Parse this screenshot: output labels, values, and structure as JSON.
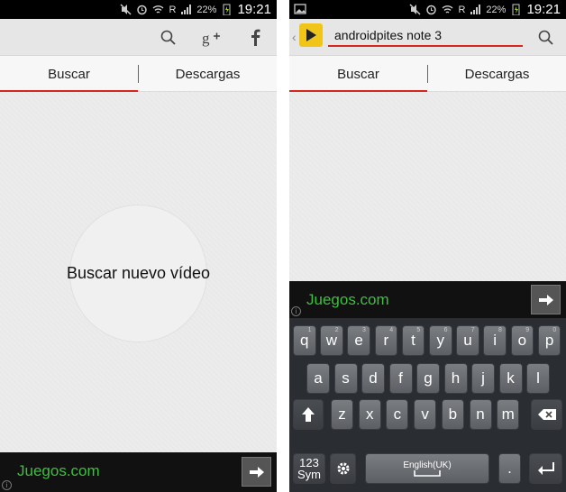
{
  "status": {
    "battery_pct": "22%",
    "time": "19:21",
    "signal_label": "R"
  },
  "left_screen": {
    "tabs": [
      {
        "label": "Buscar"
      },
      {
        "label": "Descargas"
      }
    ],
    "circle_label": "Buscar nuevo vídeo",
    "ad": {
      "text": "Juegos.com",
      "info": "i"
    }
  },
  "right_screen": {
    "search": {
      "value": "androidpites note 3",
      "placeholder": ""
    },
    "tabs": [
      {
        "label": "Buscar"
      },
      {
        "label": "Descargas"
      }
    ],
    "ad": {
      "text": "Juegos.com",
      "info": "i"
    },
    "keyboard": {
      "row1": [
        {
          "k": "q",
          "h": "1"
        },
        {
          "k": "w",
          "h": "2"
        },
        {
          "k": "e",
          "h": "3"
        },
        {
          "k": "r",
          "h": "4"
        },
        {
          "k": "t",
          "h": "5"
        },
        {
          "k": "y",
          "h": "6"
        },
        {
          "k": "u",
          "h": "7"
        },
        {
          "k": "i",
          "h": "8"
        },
        {
          "k": "o",
          "h": "9"
        },
        {
          "k": "p",
          "h": "0"
        }
      ],
      "row2": [
        {
          "k": "a"
        },
        {
          "k": "s"
        },
        {
          "k": "d"
        },
        {
          "k": "f"
        },
        {
          "k": "g"
        },
        {
          "k": "h"
        },
        {
          "k": "j"
        },
        {
          "k": "k"
        },
        {
          "k": "l"
        }
      ],
      "row3": [
        {
          "k": "z"
        },
        {
          "k": "x"
        },
        {
          "k": "c"
        },
        {
          "k": "v"
        },
        {
          "k": "b"
        },
        {
          "k": "n"
        },
        {
          "k": "m"
        }
      ],
      "sym_top": "123",
      "sym_bottom": "Sym",
      "space_label": "English(UK)",
      "period": "."
    }
  },
  "colors": {
    "accent": "#d6271d",
    "ad_text": "#3fbf3f",
    "logo": "#f0c419"
  }
}
